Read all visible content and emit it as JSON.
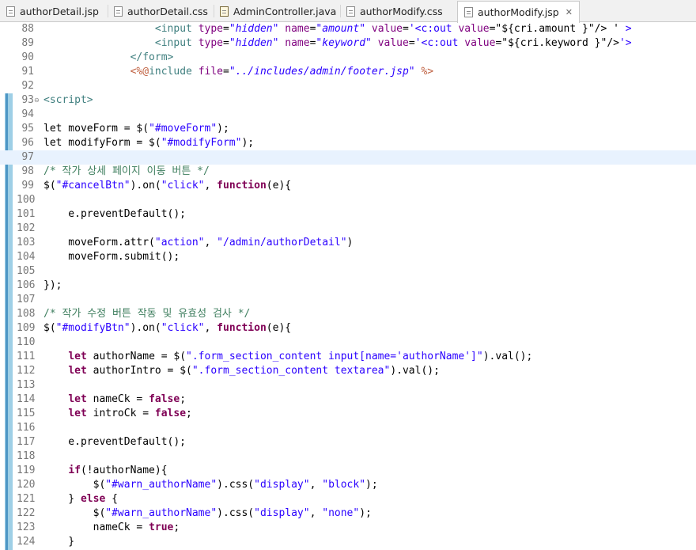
{
  "tabs": [
    {
      "label": "authorDetail.jsp",
      "icon": "jsp-file-icon"
    },
    {
      "label": "authorDetail.css",
      "icon": "css-file-icon"
    },
    {
      "label": "AdminController.java",
      "icon": "java-file-icon"
    },
    {
      "label": "authorModify.css",
      "icon": "css-file-icon"
    },
    {
      "label": "authorModify.jsp",
      "icon": "jsp-file-icon",
      "active": true
    }
  ],
  "editor": {
    "lines": [
      {
        "n": "88",
        "tokens": [
          [
            "",
            "                  "
          ],
          [
            "t",
            "<input "
          ],
          [
            "a",
            "type"
          ],
          [
            "",
            "="
          ],
          [
            "v",
            "\"hidden\""
          ],
          [
            "",
            " "
          ],
          [
            "a",
            "name"
          ],
          [
            "",
            "="
          ],
          [
            "v",
            "\"amount\""
          ],
          [
            "",
            " "
          ],
          [
            "a",
            "value"
          ],
          [
            "",
            "="
          ],
          [
            "s",
            "'<c:out "
          ],
          [
            "a",
            "value"
          ],
          [
            "",
            "=\"${cri.amount }\"/> '"
          ],
          [
            "s",
            " >"
          ]
        ]
      },
      {
        "n": "89",
        "tokens": [
          [
            "",
            "                  "
          ],
          [
            "t",
            "<input "
          ],
          [
            "a",
            "type"
          ],
          [
            "",
            "="
          ],
          [
            "v",
            "\"hidden\""
          ],
          [
            "",
            " "
          ],
          [
            "a",
            "name"
          ],
          [
            "",
            "="
          ],
          [
            "v",
            "\"keyword\""
          ],
          [
            "",
            " "
          ],
          [
            "a",
            "value"
          ],
          [
            "",
            "="
          ],
          [
            "s",
            "'<c:out "
          ],
          [
            "a",
            "value"
          ],
          [
            "",
            "=\"${cri.keyword }\"/>"
          ],
          [
            "s",
            "'>"
          ]
        ]
      },
      {
        "n": "90",
        "tokens": [
          [
            "",
            "              "
          ],
          [
            "t",
            "</form>"
          ]
        ]
      },
      {
        "n": "91",
        "tokens": [
          [
            "",
            "              "
          ],
          [
            "j",
            "<%@"
          ],
          [
            "t",
            "include "
          ],
          [
            "a",
            "file"
          ],
          [
            "",
            "="
          ],
          [
            "v",
            "\"../includes/admin/footer.jsp\""
          ],
          [
            "",
            " "
          ],
          [
            "j",
            "%>"
          ]
        ]
      },
      {
        "n": "92",
        "tokens": []
      },
      {
        "n": "93",
        "fold": true,
        "tokens": [
          [
            "t",
            "<script>"
          ]
        ]
      },
      {
        "n": "94",
        "tokens": []
      },
      {
        "n": "95",
        "tokens": [
          [
            "",
            "let moveForm = $("
          ],
          [
            "s",
            "\"#moveForm\""
          ],
          [
            "",
            ");"
          ]
        ]
      },
      {
        "n": "96",
        "tokens": [
          [
            "",
            "let modifyForm = $("
          ],
          [
            "s",
            "\"#modifyForm\""
          ],
          [
            "",
            ");"
          ]
        ]
      },
      {
        "n": "97",
        "current": true,
        "tokens": []
      },
      {
        "n": "98",
        "tokens": [
          [
            "c",
            "/* 작가 상세 페이지 이동 버튼 */"
          ]
        ]
      },
      {
        "n": "99",
        "tokens": [
          [
            "",
            "$("
          ],
          [
            "s",
            "\"#cancelBtn\""
          ],
          [
            "",
            ").on("
          ],
          [
            "s",
            "\"click\""
          ],
          [
            "",
            ", "
          ],
          [
            "k",
            "function"
          ],
          [
            "",
            "(e){"
          ]
        ]
      },
      {
        "n": "100",
        "tokens": []
      },
      {
        "n": "101",
        "tokens": [
          [
            "",
            "    e.preventDefault();"
          ]
        ]
      },
      {
        "n": "102",
        "tokens": []
      },
      {
        "n": "103",
        "tokens": [
          [
            "",
            "    moveForm.attr("
          ],
          [
            "s",
            "\"action\""
          ],
          [
            "",
            ", "
          ],
          [
            "s",
            "\"/admin/authorDetail\""
          ],
          [
            "",
            ")"
          ]
        ]
      },
      {
        "n": "104",
        "tokens": [
          [
            "",
            "    moveForm.submit();"
          ]
        ]
      },
      {
        "n": "105",
        "tokens": []
      },
      {
        "n": "106",
        "tokens": [
          [
            "",
            "});"
          ]
        ]
      },
      {
        "n": "107",
        "tokens": []
      },
      {
        "n": "108",
        "tokens": [
          [
            "c",
            "/* 작가 수정 버튼 작동 및 유효성 검사 */"
          ]
        ]
      },
      {
        "n": "109",
        "tokens": [
          [
            "",
            "$("
          ],
          [
            "s",
            "\"#modifyBtn\""
          ],
          [
            "",
            ").on("
          ],
          [
            "s",
            "\"click\""
          ],
          [
            "",
            ", "
          ],
          [
            "k",
            "function"
          ],
          [
            "",
            "(e){"
          ]
        ]
      },
      {
        "n": "110",
        "tokens": []
      },
      {
        "n": "111",
        "tokens": [
          [
            "",
            "    "
          ],
          [
            "k",
            "let"
          ],
          [
            "",
            " authorName = $("
          ],
          [
            "s",
            "\".form_section_content input[name='authorName']\""
          ],
          [
            "",
            ").val();"
          ]
        ]
      },
      {
        "n": "112",
        "tokens": [
          [
            "",
            "    "
          ],
          [
            "k",
            "let"
          ],
          [
            "",
            " authorIntro = $("
          ],
          [
            "s",
            "\".form_section_content textarea\""
          ],
          [
            "",
            ").val();"
          ]
        ]
      },
      {
        "n": "113",
        "tokens": []
      },
      {
        "n": "114",
        "tokens": [
          [
            "",
            "    "
          ],
          [
            "k",
            "let"
          ],
          [
            "",
            " nameCk = "
          ],
          [
            "k",
            "false"
          ],
          [
            "",
            ";"
          ]
        ]
      },
      {
        "n": "115",
        "tokens": [
          [
            "",
            "    "
          ],
          [
            "k",
            "let"
          ],
          [
            "",
            " introCk = "
          ],
          [
            "k",
            "false"
          ],
          [
            "",
            ";"
          ]
        ]
      },
      {
        "n": "116",
        "tokens": []
      },
      {
        "n": "117",
        "tokens": [
          [
            "",
            "    e.preventDefault();"
          ]
        ]
      },
      {
        "n": "118",
        "tokens": []
      },
      {
        "n": "119",
        "tokens": [
          [
            "",
            "    "
          ],
          [
            "k",
            "if"
          ],
          [
            "",
            "(!authorName){"
          ]
        ]
      },
      {
        "n": "120",
        "tokens": [
          [
            "",
            "        $("
          ],
          [
            "s",
            "\"#warn_authorName\""
          ],
          [
            "",
            ").css("
          ],
          [
            "s",
            "\"display\""
          ],
          [
            "",
            ", "
          ],
          [
            "s",
            "\"block\""
          ],
          [
            "",
            ");"
          ]
        ]
      },
      {
        "n": "121",
        "tokens": [
          [
            "",
            "    } "
          ],
          [
            "k",
            "else"
          ],
          [
            "",
            " {"
          ]
        ]
      },
      {
        "n": "122",
        "tokens": [
          [
            "",
            "        $("
          ],
          [
            "s",
            "\"#warn_authorName\""
          ],
          [
            "",
            ").css("
          ],
          [
            "s",
            "\"display\""
          ],
          [
            "",
            ", "
          ],
          [
            "s",
            "\"none\""
          ],
          [
            "",
            ");"
          ]
        ]
      },
      {
        "n": "123",
        "tokens": [
          [
            "",
            "        nameCk = "
          ],
          [
            "k",
            "true"
          ],
          [
            "",
            ";"
          ]
        ]
      },
      {
        "n": "124",
        "tokens": [
          [
            "",
            "    }"
          ]
        ]
      }
    ]
  }
}
